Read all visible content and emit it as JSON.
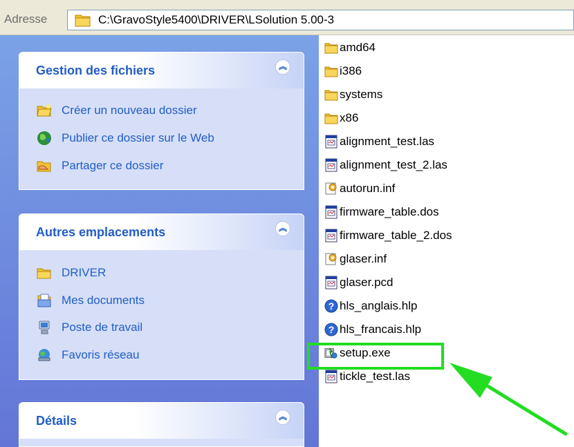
{
  "address": {
    "label": "Adresse",
    "path": "C:\\GravoStyle5400\\DRIVER\\LSolution 5.00-3"
  },
  "taskpane": {
    "file_tasks": {
      "title": "Gestion des fichiers",
      "items": [
        {
          "label": "Créer un nouveau dossier",
          "icon": "new-folder-icon"
        },
        {
          "label": "Publier ce dossier sur le Web",
          "icon": "web-publish-icon"
        },
        {
          "label": "Partager ce dossier",
          "icon": "share-folder-icon"
        }
      ]
    },
    "other_places": {
      "title": "Autres emplacements",
      "items": [
        {
          "label": "DRIVER",
          "icon": "folder-icon"
        },
        {
          "label": "Mes documents",
          "icon": "my-documents-icon"
        },
        {
          "label": "Poste de travail",
          "icon": "my-computer-icon"
        },
        {
          "label": "Favoris réseau",
          "icon": "network-places-icon"
        }
      ]
    },
    "details": {
      "title": "Détails"
    }
  },
  "files": [
    {
      "name": "amd64",
      "type": "folder"
    },
    {
      "name": "i386",
      "type": "folder"
    },
    {
      "name": "systems",
      "type": "folder"
    },
    {
      "name": "x86",
      "type": "folder"
    },
    {
      "name": "alignment_test.las",
      "type": "document"
    },
    {
      "name": "alignment_test_2.las",
      "type": "document"
    },
    {
      "name": "autorun.inf",
      "type": "settings"
    },
    {
      "name": "firmware_table.dos",
      "type": "document"
    },
    {
      "name": "firmware_table_2.dos",
      "type": "document"
    },
    {
      "name": "glaser.inf",
      "type": "settings"
    },
    {
      "name": "glaser.pcd",
      "type": "document"
    },
    {
      "name": "hls_anglais.hlp",
      "type": "help"
    },
    {
      "name": "hls_francais.hlp",
      "type": "help"
    },
    {
      "name": "setup.exe",
      "type": "setup"
    },
    {
      "name": "tickle_test.las",
      "type": "document"
    }
  ],
  "colors": {
    "highlight": "#22dd22",
    "task_link": "#215dc6",
    "pane_top": "#7ba2e7",
    "pane_bottom": "#6375d6"
  }
}
